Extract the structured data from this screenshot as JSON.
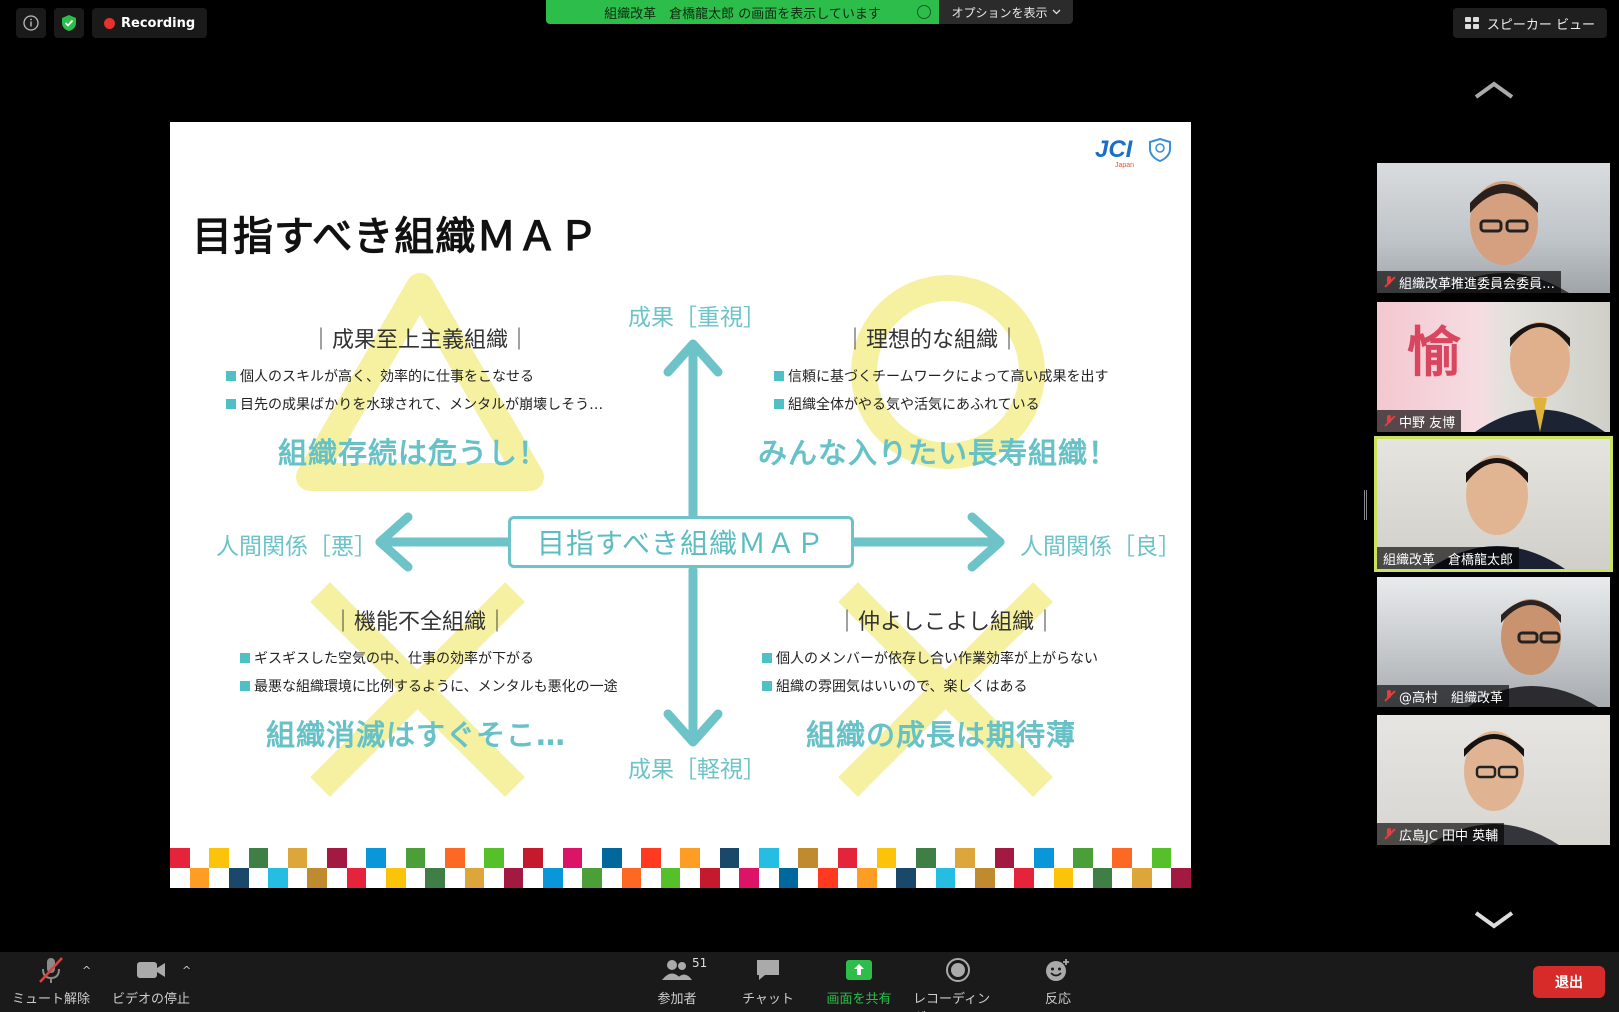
{
  "top_bar": {
    "recording_label": "Recording",
    "info_icon": "info-icon",
    "security_icon": "shield-check-icon",
    "share_banner": "組織改革　倉橋龍太郎 の画面を表示しています",
    "options_label": "オプションを表示",
    "speaker_view_label": "スピーカー ビュー"
  },
  "slide": {
    "title": "目指すべき組織ＭＡＰ",
    "logo_text": "JCI",
    "logo_sub": "Japan",
    "center_label": "目指すべき組織ＭＡＰ",
    "axis": {
      "top": "成果［重視］",
      "bottom": "成果［軽視］",
      "left": "人間関係［悪］",
      "right": "人間関係［良］"
    },
    "quadrants": [
      {
        "title": "｜成果至上主義組織｜",
        "bullets": [
          "個人のスキルが高く、効率的に仕事をこなせる",
          "目先の成果ばかりを水球されて、メンタルが崩壊しそう…"
        ],
        "phrase": "組織存続は危うし！",
        "symbol": "triangle"
      },
      {
        "title": "｜理想的な組織｜",
        "bullets": [
          "信頼に基づくチームワークによって高い成果を出す",
          "組織全体がやる気や活気にあふれている"
        ],
        "phrase": "みんな入りたい長寿組織！",
        "symbol": "circle"
      },
      {
        "title": "｜機能不全組織｜",
        "bullets": [
          "ギスギスした空気の中、仕事の効率が下がる",
          "最悪な組織環境に比例するように、メンタルも悪化の一途"
        ],
        "phrase": "組織消滅はすぐそこ…",
        "symbol": "cross"
      },
      {
        "title": "｜仲よしこよし組織｜",
        "bullets": [
          "個人のメンバーが依存し合い作業効率が上がらない",
          "組織の雰囲気はいいので、楽しくはある"
        ],
        "phrase": "組織の成長は期待薄",
        "symbol": "cross"
      }
    ],
    "colors": {
      "accent": "#6dc3c8",
      "symbol_yellow": "#f6f1a0"
    }
  },
  "participants": [
    {
      "name": "組織改革推進委員会委員…",
      "muted": true,
      "active": false
    },
    {
      "name": "中野 友博",
      "muted": true,
      "active": false
    },
    {
      "name": "組織改革　倉橋龍太郎",
      "muted": false,
      "active": true
    },
    {
      "name": "@高村　組織改革",
      "muted": true,
      "active": false
    },
    {
      "name": "広島JC 田中 英輔",
      "muted": true,
      "active": false
    }
  ],
  "toolbar": {
    "mute_label": "ミュート解除",
    "video_label": "ビデオの停止",
    "participants_label": "参加者",
    "participants_count": "51",
    "chat_label": "チャット",
    "share_label": "画面を共有",
    "record_label": "レコーディング",
    "reactions_label": "反応",
    "leave_label": "退出"
  }
}
